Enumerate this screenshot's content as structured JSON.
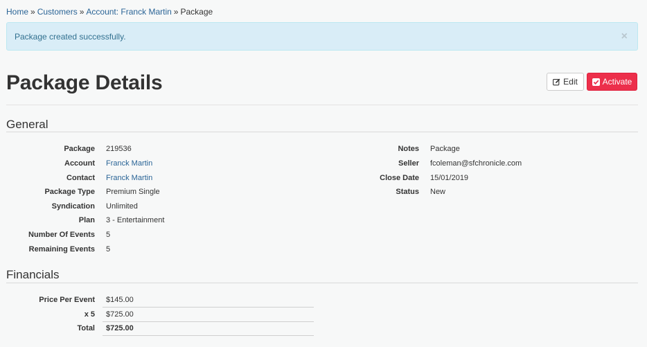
{
  "breadcrumb": {
    "items": [
      "Home",
      "Customers",
      "Account: Franck Martin"
    ],
    "separator": "»",
    "current": "Package"
  },
  "alert": {
    "message": "Package created successfully.",
    "close": "×"
  },
  "header": {
    "title": "Package Details",
    "edit_label": "Edit",
    "activate_label": "Activate"
  },
  "general": {
    "heading": "General",
    "left": [
      {
        "label": "Package",
        "value": "219536"
      },
      {
        "label": "Account",
        "value": "Franck Martin"
      },
      {
        "label": "Contact",
        "value": "Franck Martin"
      },
      {
        "label": "Package Type",
        "value": "Premium Single"
      },
      {
        "label": "Syndication",
        "value": "Unlimited"
      },
      {
        "label": "Plan",
        "value": "3 - Entertainment"
      },
      {
        "label": "Number Of Events",
        "value": "5"
      },
      {
        "label": "Remaining Events",
        "value": "5"
      }
    ],
    "right": [
      {
        "label": "Notes",
        "value": "Package"
      },
      {
        "label": "Seller",
        "value": "fcoleman@sfchronicle.com"
      },
      {
        "label": "Close Date",
        "value": "15/01/2019"
      },
      {
        "label": "Status",
        "value": "New"
      }
    ]
  },
  "financials": {
    "heading": "Financials",
    "rows": [
      {
        "label": "Price Per Event",
        "value": "$145.00"
      },
      {
        "label": "x 5",
        "value": "$725.00"
      },
      {
        "label": "Total",
        "value": "$725.00"
      }
    ]
  },
  "colors": {
    "link": "#2a6496",
    "alert_bg": "#d9edf7",
    "activate_bg": "#ec2f4b"
  },
  "icons": {
    "edit": "pencil-square-icon",
    "activate": "check-square-icon"
  }
}
